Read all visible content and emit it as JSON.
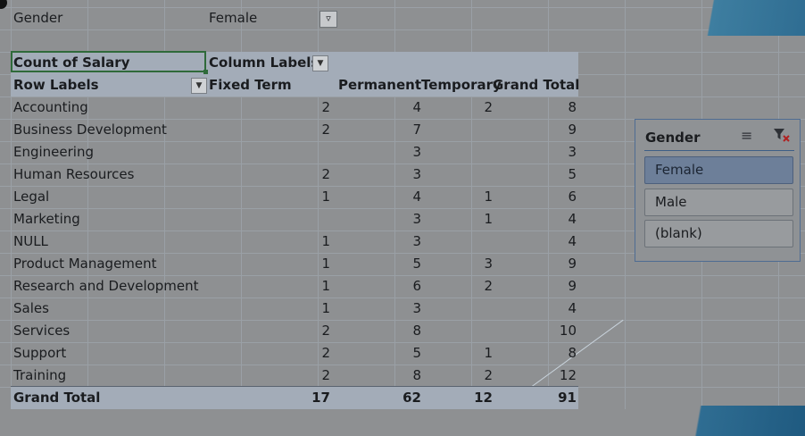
{
  "filter": {
    "field": "Gender",
    "value": "Female"
  },
  "pivot": {
    "corner_label": "Count of Salary",
    "column_labels": "Column Labels",
    "row_labels": "Row Labels",
    "columns": [
      "Fixed Term",
      "Permanent",
      "Temporary",
      "Grand Total"
    ],
    "rows": [
      {
        "label": "Accounting",
        "ft": "2",
        "perm": "4",
        "temp": "2",
        "gt": "8"
      },
      {
        "label": "Business Development",
        "ft": "2",
        "perm": "7",
        "temp": "",
        "gt": "9"
      },
      {
        "label": "Engineering",
        "ft": "",
        "perm": "3",
        "temp": "",
        "gt": "3"
      },
      {
        "label": "Human Resources",
        "ft": "2",
        "perm": "3",
        "temp": "",
        "gt": "5"
      },
      {
        "label": "Legal",
        "ft": "1",
        "perm": "4",
        "temp": "1",
        "gt": "6"
      },
      {
        "label": "Marketing",
        "ft": "",
        "perm": "3",
        "temp": "1",
        "gt": "4"
      },
      {
        "label": "NULL",
        "ft": "1",
        "perm": "3",
        "temp": "",
        "gt": "4"
      },
      {
        "label": "Product Management",
        "ft": "1",
        "perm": "5",
        "temp": "3",
        "gt": "9"
      },
      {
        "label": "Research and Development",
        "ft": "1",
        "perm": "6",
        "temp": "2",
        "gt": "9"
      },
      {
        "label": "Sales",
        "ft": "1",
        "perm": "3",
        "temp": "",
        "gt": "4"
      },
      {
        "label": "Services",
        "ft": "2",
        "perm": "8",
        "temp": "",
        "gt": "10"
      },
      {
        "label": "Support",
        "ft": "2",
        "perm": "5",
        "temp": "1",
        "gt": "8"
      },
      {
        "label": "Training",
        "ft": "2",
        "perm": "8",
        "temp": "2",
        "gt": "12"
      }
    ],
    "grand_total": {
      "label": "Grand Total",
      "ft": "17",
      "perm": "62",
      "temp": "12",
      "gt": "91"
    }
  },
  "slicer": {
    "title": "Gender",
    "items": [
      "Female",
      "Male",
      "(blank)"
    ],
    "selected": "Female"
  }
}
